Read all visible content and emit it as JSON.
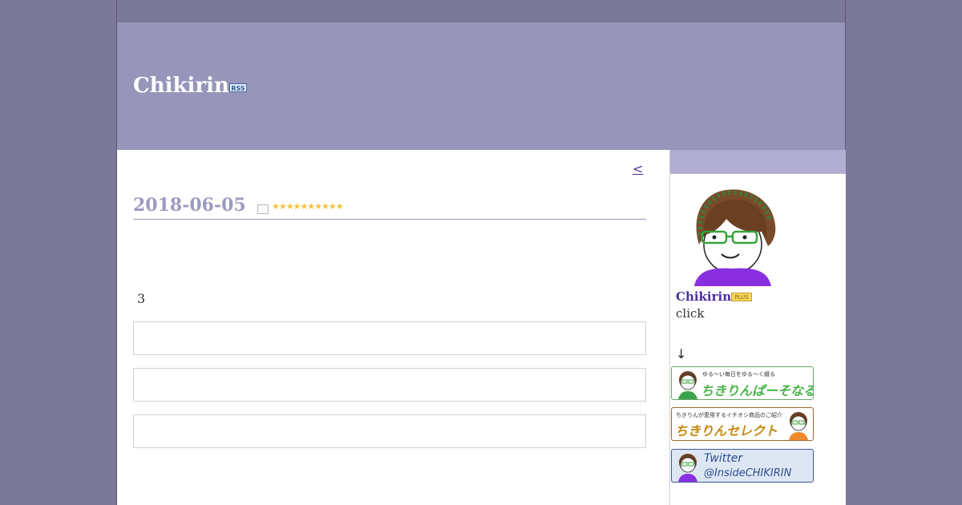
{
  "header": {
    "title": "Chikirin",
    "rss_label": "RSS"
  },
  "main": {
    "pager_prev": "<",
    "date": "2018-06-05",
    "stars": "★★★★★★★★★★",
    "body_text": "3"
  },
  "sidebar": {
    "profile_name": "Chikirin",
    "plus_badge": "PLUS",
    "click_text": "click",
    "arrow": "↓",
    "banners": [
      {
        "small": "ゆる〜い毎日をゆる〜く綴る",
        "big": "ちきりんぱーそなる"
      },
      {
        "small": "ちきりんが愛用するイチオシ商品のご紹介",
        "big": "ちきりんセレクト"
      },
      {
        "line1": "Twitter",
        "line2": "@InsideCHIKIRIN"
      }
    ]
  },
  "colors": {
    "background": "#7c7899",
    "header": "#9895bb",
    "sidebar_head": "#b1aed2",
    "link": "#4a2f9a",
    "date": "#9c9ac0"
  }
}
